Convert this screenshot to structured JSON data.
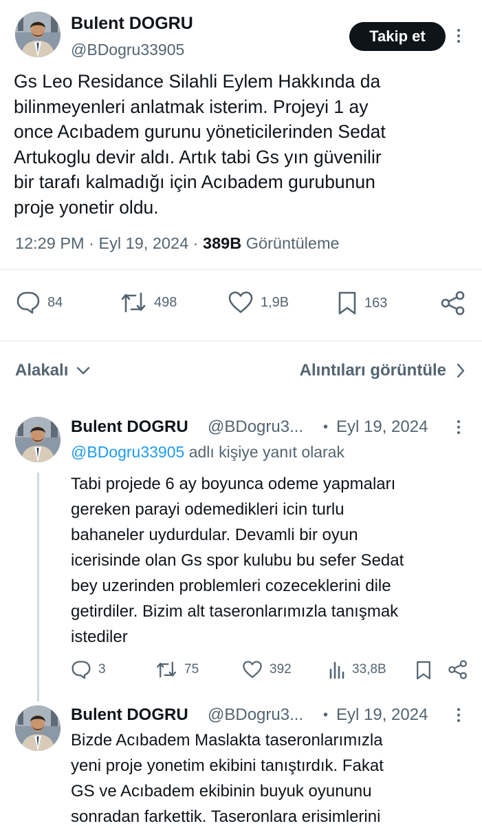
{
  "main_tweet": {
    "author_name": "Bulent DOGRU",
    "author_handle": "@BDogru33905",
    "follow_label": "Takip et",
    "text_lines": [
      "Gs Leo Residance Silahli Eylem Hakkında da",
      "bilinmeyenleri anlatmak isterim. Projeyi 1 ay",
      "once Acıbadem gurunu yöneticilerinden Sedat",
      "Artukoglu devir aldı. Artık tabi Gs yın güvenilir",
      "bir tarafı kalmadığı için Acıbadem gurubunun",
      "proje yonetir oldu."
    ],
    "time": "12:29 PM",
    "date": "Eyl 19, 2024",
    "views_count": "389B",
    "views_label": "Görüntüleme",
    "actions": {
      "replies": "84",
      "reposts": "498",
      "likes": "1,9B",
      "bookmarks": "163"
    }
  },
  "filters": {
    "relevant_label": "Alakalı",
    "quotes_label": "Alıntıları görüntüle"
  },
  "replies": [
    {
      "author_name": "Bulent DOGRU",
      "author_handle": "@BDogru3...",
      "date": "Eyl 19, 2024",
      "reply_to_handle": "@BDogru33905",
      "reply_to_suffix": "adlı kişiye yanıt olarak",
      "text_lines": [
        "Tabi projede 6 ay boyunca odeme yapmaları",
        "gereken parayi odemedikleri icin turlu",
        "bahaneler uydurdular. Devamli bir oyun",
        "icerisinde olan Gs spor kulubu bu sefer Sedat",
        "bey uzerinden problemleri cozeceklerini dile",
        "getirdiler. Bizim alt taseronlarımızla tanışmak",
        "istediler"
      ],
      "actions": {
        "replies": "3",
        "reposts": "75",
        "likes": "392",
        "views": "33,8B"
      }
    },
    {
      "author_name": "Bulent DOGRU",
      "author_handle": "@BDogru3...",
      "date": "Eyl 19, 2024",
      "text_lines": [
        "Bizde Acıbadem Maslakta taseronlarımızla",
        "yeni proje yonetim ekibini tanıştırdık. Fakat",
        "GS ve Acıbadem ekibinin buyuk oyununu",
        "sonradan farkettik. Taseronlara erisimlerini"
      ]
    }
  ],
  "colors": {
    "text_primary": "#0f1419",
    "text_secondary": "#536471",
    "link": "#1d9bf0",
    "button_bg": "#0f1419",
    "divider": "#e6e9eb"
  },
  "icons": {
    "avatar": "avatar",
    "more": "more-vertical-icon",
    "reply": "comment-icon",
    "repost": "repost-icon",
    "like": "heart-icon",
    "bookmark": "bookmark-icon",
    "share": "share-icon",
    "views": "views-icon",
    "chevron_down": "chevron-down-icon",
    "chevron_right": "chevron-right-icon"
  }
}
